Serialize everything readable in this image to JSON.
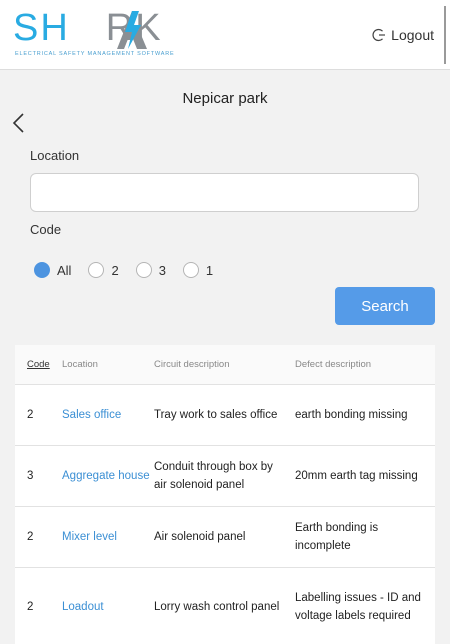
{
  "header": {
    "logo_left": "SH",
    "logo_right": "RK",
    "logo_tagline": "ELECTRICAL SAFETY MANAGEMENT SOFTWARE",
    "logout_label": "Logout"
  },
  "page": {
    "title": "Nepicar park"
  },
  "filters": {
    "location_label": "Location",
    "location_value": "",
    "code_label": "Code",
    "code_options": [
      {
        "label": "All",
        "checked": true
      },
      {
        "label": "2",
        "checked": false
      },
      {
        "label": "3",
        "checked": false
      },
      {
        "label": "1",
        "checked": false
      }
    ],
    "search_label": "Search"
  },
  "table": {
    "headers": {
      "code": "Code",
      "location": "Location",
      "circuit": "Circuit description",
      "defect": "Defect description"
    },
    "rows": [
      {
        "code": "2",
        "location": "Sales office",
        "circuit": "Tray work to sales office",
        "defect": "earth bonding missing"
      },
      {
        "code": "3",
        "location": "Aggregate house",
        "circuit": "Conduit through box by air solenoid panel",
        "defect": "20mm earth tag missing"
      },
      {
        "code": "2",
        "location": "Mixer level",
        "circuit": "Air solenoid panel",
        "defect": "Earth bonding is incomplete"
      },
      {
        "code": "2",
        "location": "Loadout",
        "circuit": "Lorry wash control panel",
        "defect": "Labelling issues - ID and voltage labels required"
      }
    ]
  },
  "colors": {
    "accent": "#559be8",
    "link": "#3b8fd4",
    "logo_blue": "#29abe2",
    "logo_grey": "#8a8f94"
  }
}
